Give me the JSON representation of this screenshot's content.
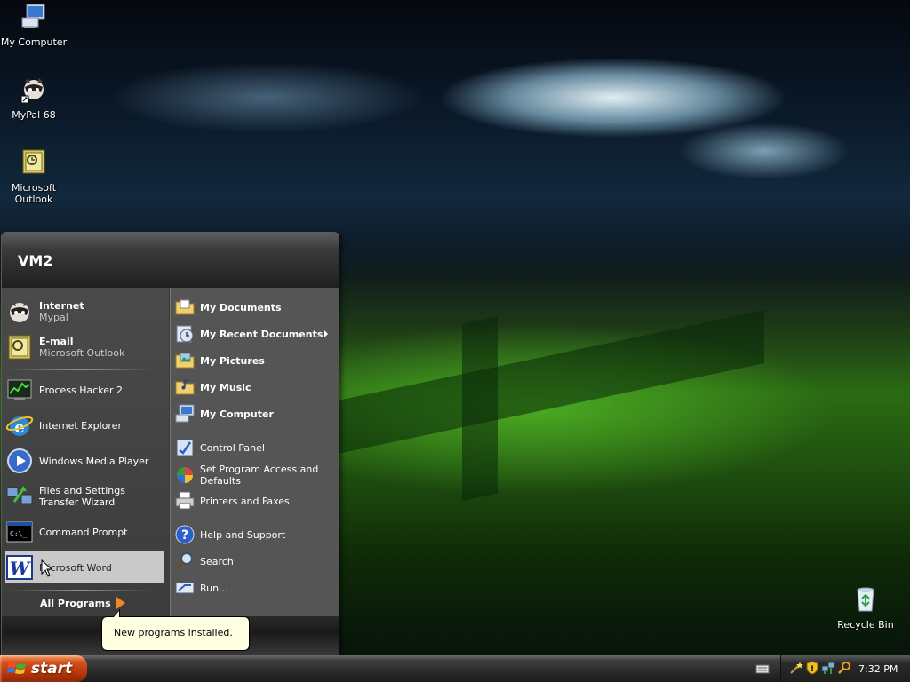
{
  "desktop": {
    "icons": [
      {
        "label": "My Computer"
      },
      {
        "label": "MyPal 68"
      },
      {
        "label": "Microsoft Outlook"
      },
      {
        "label": "Recycle Bin"
      }
    ]
  },
  "start_menu": {
    "user": "VM2",
    "pinned": [
      {
        "title": "Internet",
        "subtitle": "Mypal"
      },
      {
        "title": "E-mail",
        "subtitle": "Microsoft Outlook"
      }
    ],
    "recent": [
      {
        "label": "Process Hacker 2"
      },
      {
        "label": "Internet Explorer"
      },
      {
        "label": "Windows Media Player"
      },
      {
        "label": "Files and Settings Transfer Wizard"
      },
      {
        "label": "Command Prompt"
      },
      {
        "label": "Microsoft Word"
      }
    ],
    "all_programs": "All Programs",
    "places": [
      {
        "label": "My Documents"
      },
      {
        "label": "My Recent Documents"
      },
      {
        "label": "My Pictures"
      },
      {
        "label": "My Music"
      },
      {
        "label": "My Computer"
      }
    ],
    "settings": [
      {
        "label": "Control Panel"
      },
      {
        "label": "Set Program Access and Defaults"
      },
      {
        "label": "Printers and Faxes"
      }
    ],
    "help": [
      {
        "label": "Help and Support"
      },
      {
        "label": "Search"
      },
      {
        "label": "Run..."
      }
    ]
  },
  "balloon": {
    "text": "New programs installed."
  },
  "taskbar": {
    "start_label": "start",
    "clock": "7:32 PM"
  },
  "colors": {
    "start_button": "#c8460f",
    "menu_bg": "#3c3c3c",
    "balloon_bg": "#ffffe1"
  }
}
